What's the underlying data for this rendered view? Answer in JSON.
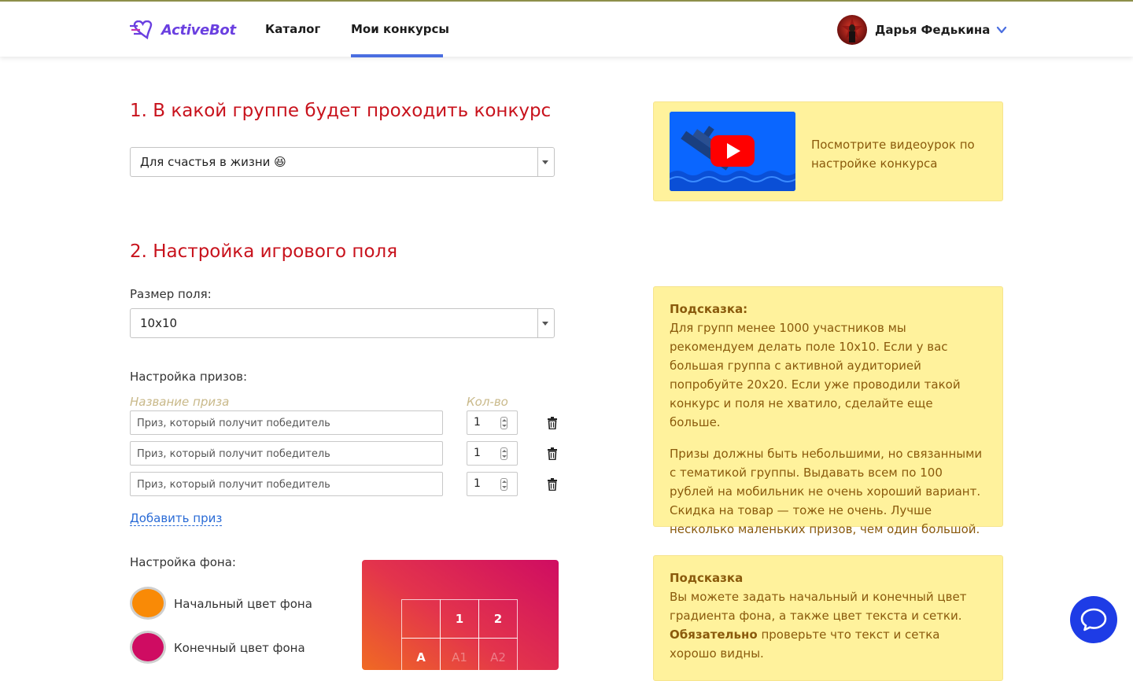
{
  "header": {
    "logo_text": "ActiveBot",
    "nav": [
      {
        "label": "Каталог",
        "active": false
      },
      {
        "label": "Мои конкурсы",
        "active": true
      }
    ],
    "user_name": "Дарья Федькина",
    "accent_color": "#4a6ee0"
  },
  "section1": {
    "title": "1. В какой группе будет проходить конкурс",
    "group_select_value": "Для счастья в жизни 😆"
  },
  "video_card": {
    "text": "Посмотрите видеоурок по настройке конкурса"
  },
  "section2": {
    "title": "2. Настройка игрового поля",
    "size_label": "Размер поля:",
    "size_value": "10x10",
    "prizes_label": "Настройка призов:",
    "col_name": "Название приза",
    "col_qty": "Кол-во",
    "prizes": [
      {
        "placeholder": "Приз, который получит победитель",
        "qty": "1"
      },
      {
        "placeholder": "Приз, который получит победитель",
        "qty": "1"
      },
      {
        "placeholder": "Приз, который получит победитель",
        "qty": "1"
      }
    ],
    "add_prize": "Добавить приз",
    "bg_label": "Настройка фона:",
    "bg_start_label": "Начальный цвет фона",
    "bg_end_label": "Конечный цвет фона",
    "bg_start_color": "#f98a06",
    "bg_end_color": "#cf0c62",
    "preview_grid": {
      "row1": [
        "",
        "1",
        "2"
      ],
      "row2": [
        "A",
        "A1",
        "A2"
      ]
    }
  },
  "hint1": {
    "title": "Подсказка:",
    "p1": "Для групп менее 1000 участников мы рекомендуем делать поле 10x10. Если у вас большая группа с активной аудиторией попробуйте 20x20. Если уже проводили такой конкурс и поля не хватило, сделайте еще больше.",
    "p2": "Призы должны быть небольшими, но связанными с тематикой группы. Выдавать всем по 100 рублей на мобильник не очень хороший вариант. Скидка на товар — тоже не очень. Лучше несколько маленьких призов, чем один большой."
  },
  "hint2": {
    "title": "Подсказка",
    "p1": "Вы можете задать начальный и конечный цвет градиента фона, а также цвет текста и сетки.",
    "p2_bold": "Обязательно",
    "p2_rest": " проверьте что текст и сетка хорошо видны."
  }
}
